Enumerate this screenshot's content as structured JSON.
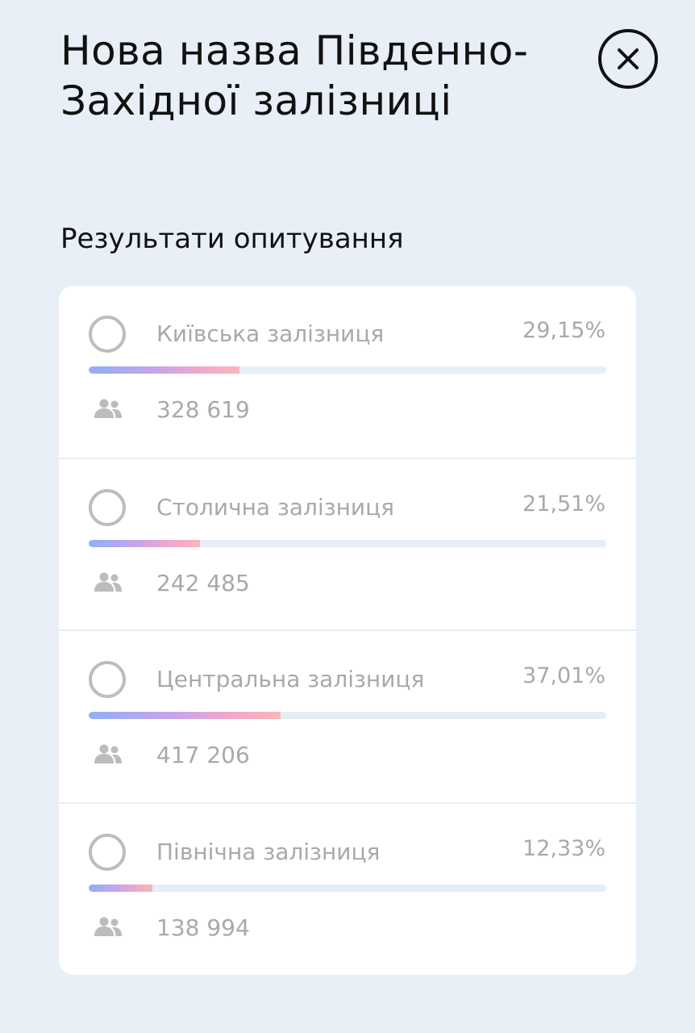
{
  "title": "Нова назва Південно-Західної залізниці",
  "subtitle": "Результати опитування",
  "options": [
    {
      "label": "Київська залізниця",
      "percent_text": "29,15%",
      "percent": 29.15,
      "votes": "328 619"
    },
    {
      "label": "Столична залізниця",
      "percent_text": "21,51%",
      "percent": 21.51,
      "votes": "242 485"
    },
    {
      "label": "Центральна залізниця",
      "percent_text": "37,01%",
      "percent": 37.01,
      "votes": "417 206"
    },
    {
      "label": "Північна залізниця",
      "percent_text": "12,33%",
      "percent": 12.33,
      "votes": "138 994"
    }
  ],
  "icons": {
    "close": "close-icon",
    "voters": "people-icon"
  },
  "colors": {
    "background": "#e8eff7",
    "card": "#ffffff",
    "text_primary": "#111111",
    "text_muted": "#a9a9a9",
    "track": "#e6edf6",
    "bar_gradient": [
      "#8fb0f5",
      "#c9a4ea",
      "#f1a9c9",
      "#f7b7b7"
    ]
  }
}
